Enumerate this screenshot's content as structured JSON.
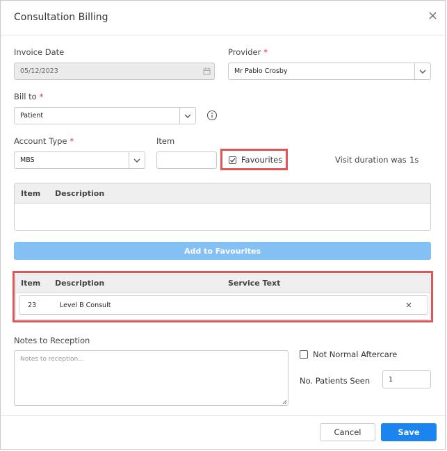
{
  "dialog": {
    "title": "Consultation Billing"
  },
  "form": {
    "invoice_date_label": "Invoice Date",
    "invoice_date_value": "05/12/2023",
    "provider_label": "Provider",
    "provider_value": "Mr Pablo Crosby",
    "bill_to_label": "Bill to",
    "bill_to_value": "Patient",
    "account_type_label": "Account Type",
    "account_type_value": "MBS",
    "item_label": "Item",
    "item_value": "",
    "favourites_label": "Favourites",
    "favourites_checked": true,
    "visit_duration_label": "Visit duration was",
    "visit_duration_value": "1s",
    "required_mark": "*"
  },
  "favourites_grid": {
    "columns": [
      "Item",
      "Description"
    ],
    "rows": []
  },
  "add_to_favourites_label": "Add to Favourites",
  "selected_grid": {
    "columns": [
      "Item",
      "Description",
      "Service Text"
    ],
    "rows": [
      {
        "item": "23",
        "description": "Level B Consult",
        "service_text": ""
      }
    ]
  },
  "notes": {
    "label": "Notes to Reception",
    "placeholder": "Notes to reception...",
    "value": ""
  },
  "not_normal_aftercare_label": "Not Normal Aftercare",
  "patients_seen": {
    "label": "No. Patients Seen",
    "value": "1"
  },
  "footer": {
    "cancel_label": "Cancel",
    "save_label": "Save"
  },
  "colors": {
    "primary": "#1b84ee",
    "primary_disabled": "#85c0f5",
    "required": "#d9342b",
    "highlight": "#e05558"
  }
}
